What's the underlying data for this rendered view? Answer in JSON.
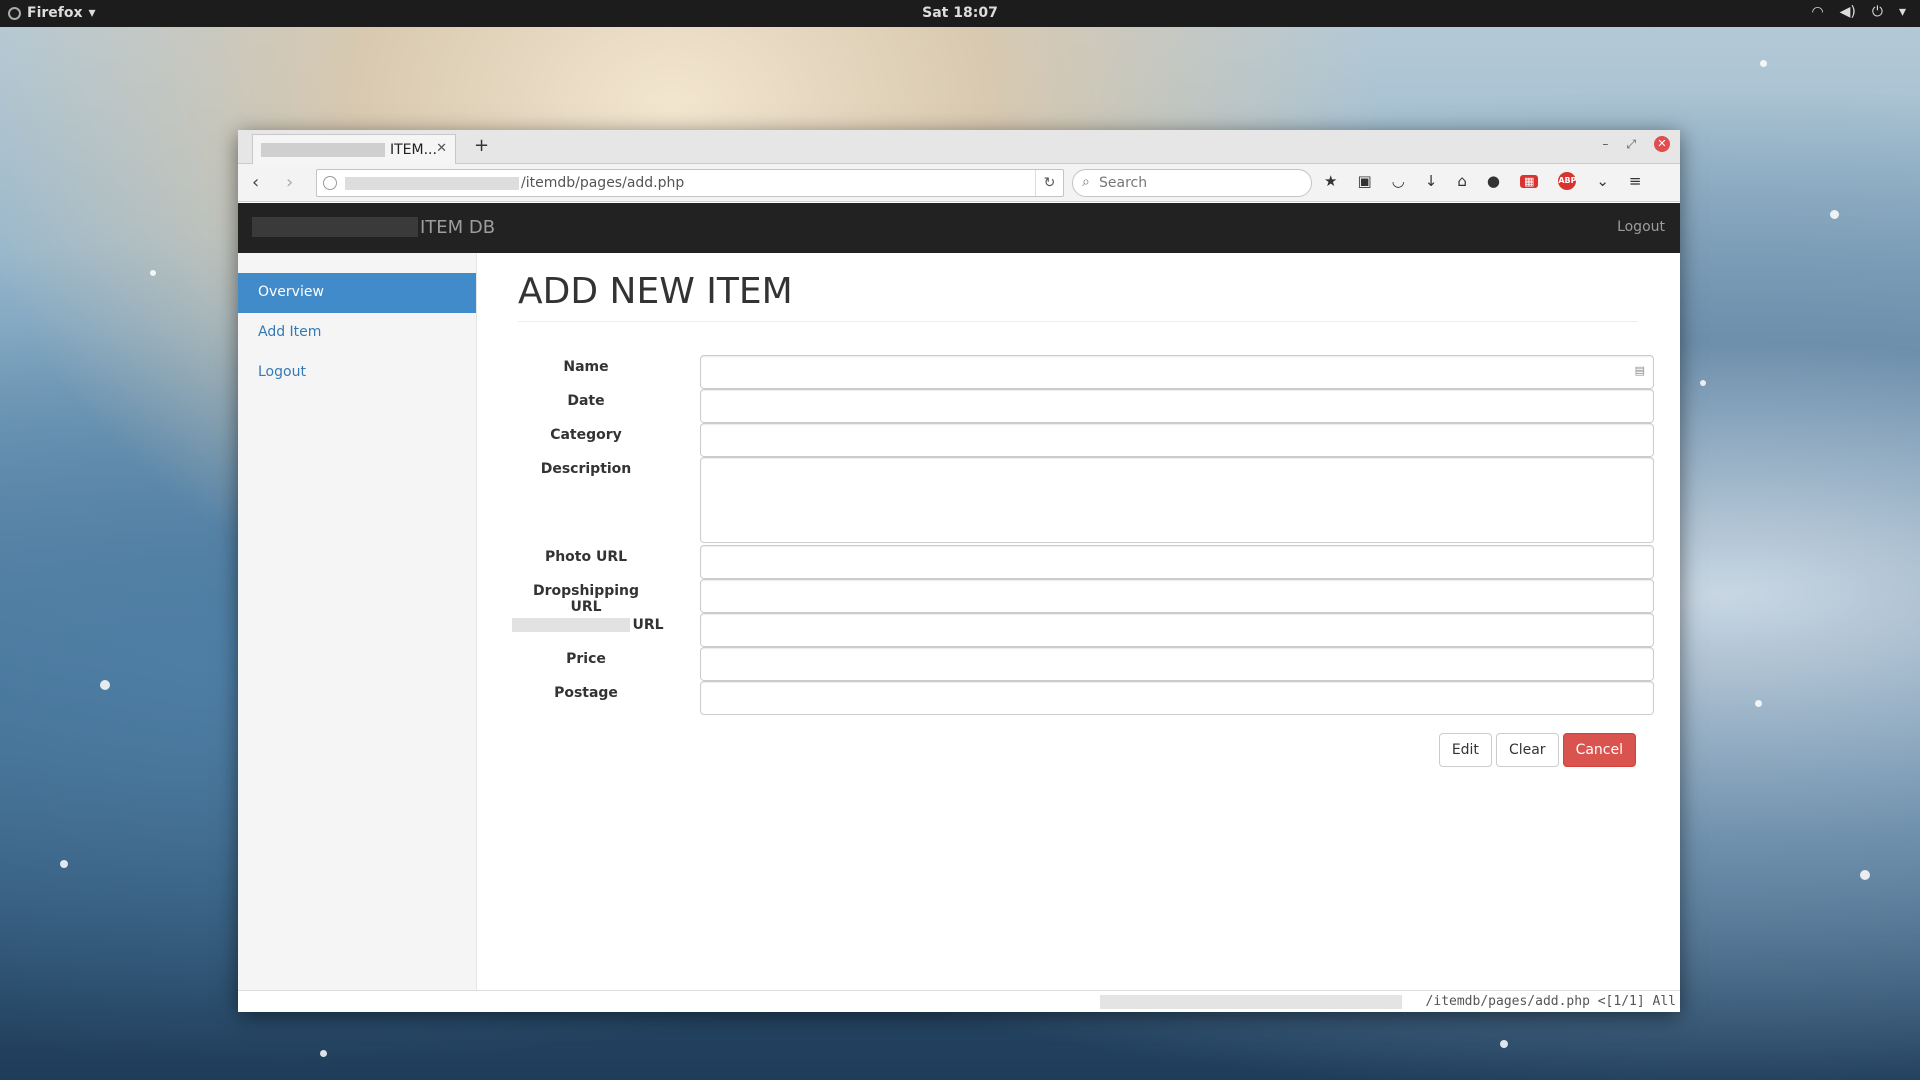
{
  "desktop": {
    "app_name": "Firefox",
    "clock": "Sat 18:07"
  },
  "browser": {
    "tab_title": "ITEM...",
    "url_path": "/itemdb/pages/add.php",
    "search_placeholder": "Search"
  },
  "app": {
    "brand": "ITEM DB",
    "header_logout": "Logout",
    "sidebar": [
      {
        "label": "Overview",
        "active": true
      },
      {
        "label": "Add Item",
        "active": false
      },
      {
        "label": "Logout",
        "active": false
      }
    ],
    "page_title": "ADD NEW ITEM",
    "form": {
      "name": "Name",
      "date": "Date",
      "category": "Category",
      "description": "Description",
      "photo_url": "Photo URL",
      "dropshipping_url": "Dropshipping URL",
      "other_url": "URL",
      "price": "Price",
      "postage": "Postage"
    },
    "buttons": {
      "edit": "Edit",
      "clear": "Clear",
      "cancel": "Cancel"
    }
  },
  "statusbar": {
    "text": "/itemdb/pages/add.php <[1/1] All"
  },
  "colors": {
    "primary": "#428bca",
    "danger": "#d9534f",
    "navbar": "#222222"
  }
}
